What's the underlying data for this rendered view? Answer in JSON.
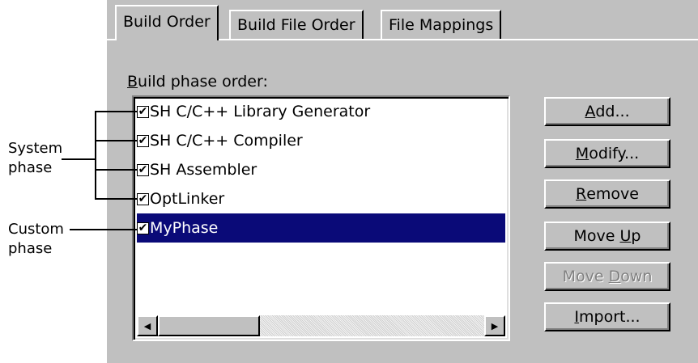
{
  "tabs": [
    {
      "label": "Build Order",
      "active": true
    },
    {
      "label": "Build File Order",
      "active": false
    },
    {
      "label": "File Mappings",
      "active": false
    }
  ],
  "group_label": {
    "mnemonic": "B",
    "rest": "uild phase order:"
  },
  "phases": [
    {
      "label": "SH C/C++ Library Generator",
      "checked": true,
      "selected": false
    },
    {
      "label": "SH C/C++ Compiler",
      "checked": true,
      "selected": false
    },
    {
      "label": "SH Assembler",
      "checked": true,
      "selected": false
    },
    {
      "label": "OptLinker",
      "checked": true,
      "selected": false
    },
    {
      "label": "MyPhase",
      "checked": true,
      "selected": true
    }
  ],
  "checkmark": "✔",
  "scroll": {
    "left_arrow": "◀",
    "right_arrow": "▶"
  },
  "buttons": {
    "add": {
      "mnemonic": "A",
      "rest": "dd..."
    },
    "modify": {
      "mnemonic": "M",
      "rest": "odify..."
    },
    "remove": {
      "mnemonic": "R",
      "rest": "emove"
    },
    "move_up": {
      "pre": "Move ",
      "mnemonic": "U",
      "rest": "p"
    },
    "move_down": {
      "pre": "Move ",
      "mnemonic": "D",
      "rest": "own",
      "disabled": true
    },
    "import": {
      "mnemonic": "I",
      "rest": "mport..."
    }
  },
  "annotations": {
    "system_phase": [
      "System",
      "phase"
    ],
    "custom_phase": [
      "Custom",
      "phase"
    ]
  },
  "colors": {
    "selection": "#0a0a78",
    "dialog_bg": "#c0c0c0"
  }
}
